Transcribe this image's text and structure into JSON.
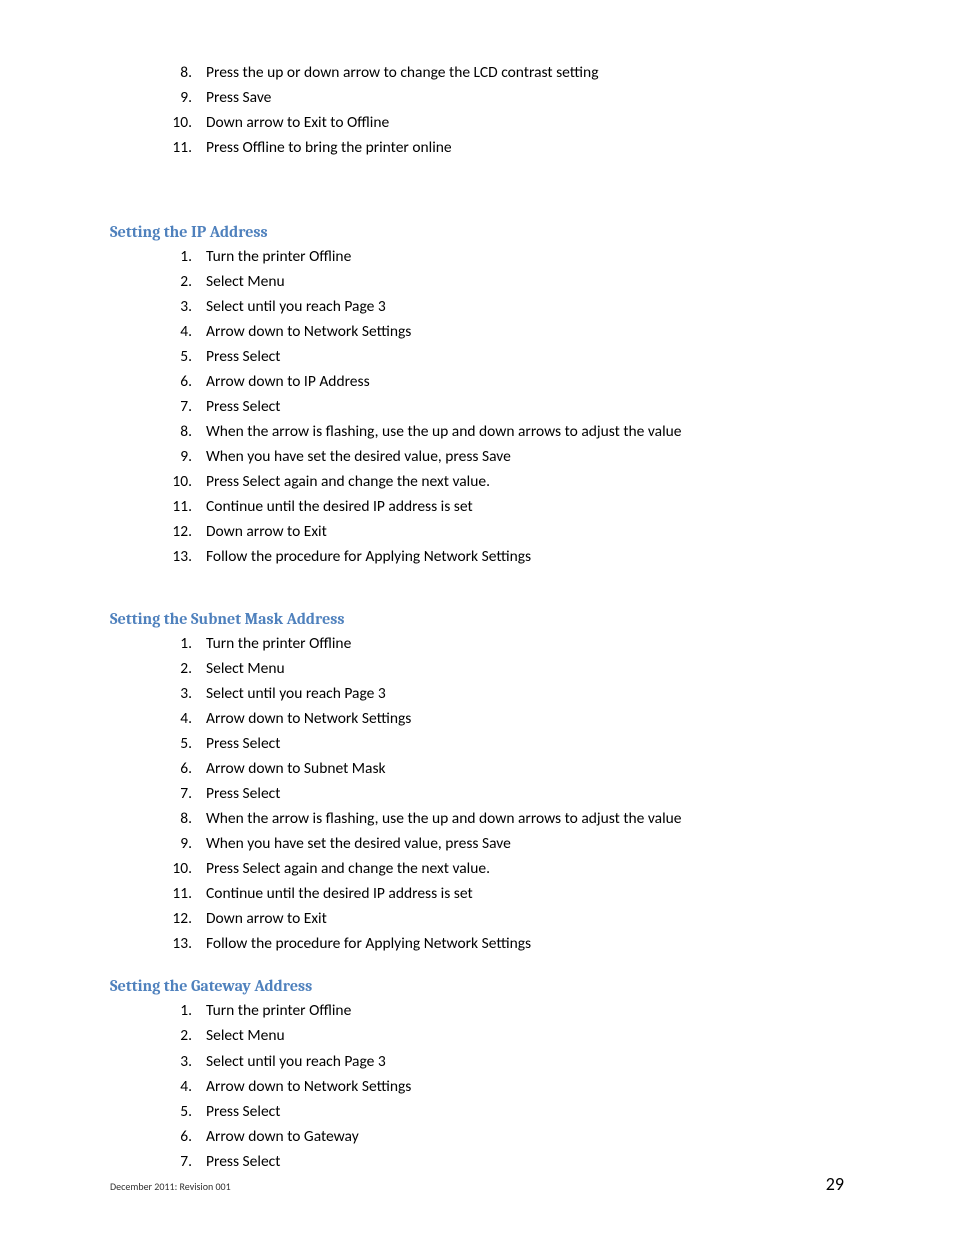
{
  "intro_list": {
    "start": 8,
    "items": [
      "Press the up or down arrow to change the LCD contrast setting",
      "Press Save",
      "Down arrow to Exit to Offline",
      "Press Offline to bring the printer online"
    ]
  },
  "sections": [
    {
      "heading": "Setting the IP Address",
      "gap_before": "large",
      "start": 1,
      "items": [
        "Turn the printer Offline",
        "Select Menu",
        "Select until you reach Page 3",
        "Arrow down to Network Settings",
        "Press Select",
        "Arrow down to IP Address",
        "Press Select",
        "When the arrow is flashing, use the up and down arrows to adjust the value",
        "When you have set the desired value, press Save",
        "Press Select again and change the next value.",
        "Continue until the desired IP address is set",
        "Down arrow to Exit",
        "Follow the procedure for Applying Network Settings"
      ]
    },
    {
      "heading": "Setting the Subnet Mask  Address",
      "gap_before": "med",
      "start": 1,
      "items": [
        "Turn the printer Offline",
        "Select Menu",
        "Select until you reach Page 3",
        "Arrow down to Network Settings",
        "Press Select",
        "Arrow down to Subnet Mask",
        "Press Select",
        "When the arrow is flashing, use the up and down arrows to adjust the value",
        "When you have set the desired value, press Save",
        "Press Select again and change the next value.",
        "Continue until the desired IP address is set",
        "Down arrow to Exit",
        "Follow the procedure for Applying Network Settings"
      ]
    },
    {
      "heading": "Setting the Gateway Address",
      "gap_before": "small",
      "start": 1,
      "items": [
        "Turn the printer Offline",
        "Select Menu",
        "Select until you reach Page 3",
        "Arrow down to Network Settings",
        "Press Select",
        "Arrow down to Gateway",
        "Press Select"
      ]
    }
  ],
  "footer": {
    "left": "December 2011: Revision 001",
    "right": "29"
  }
}
